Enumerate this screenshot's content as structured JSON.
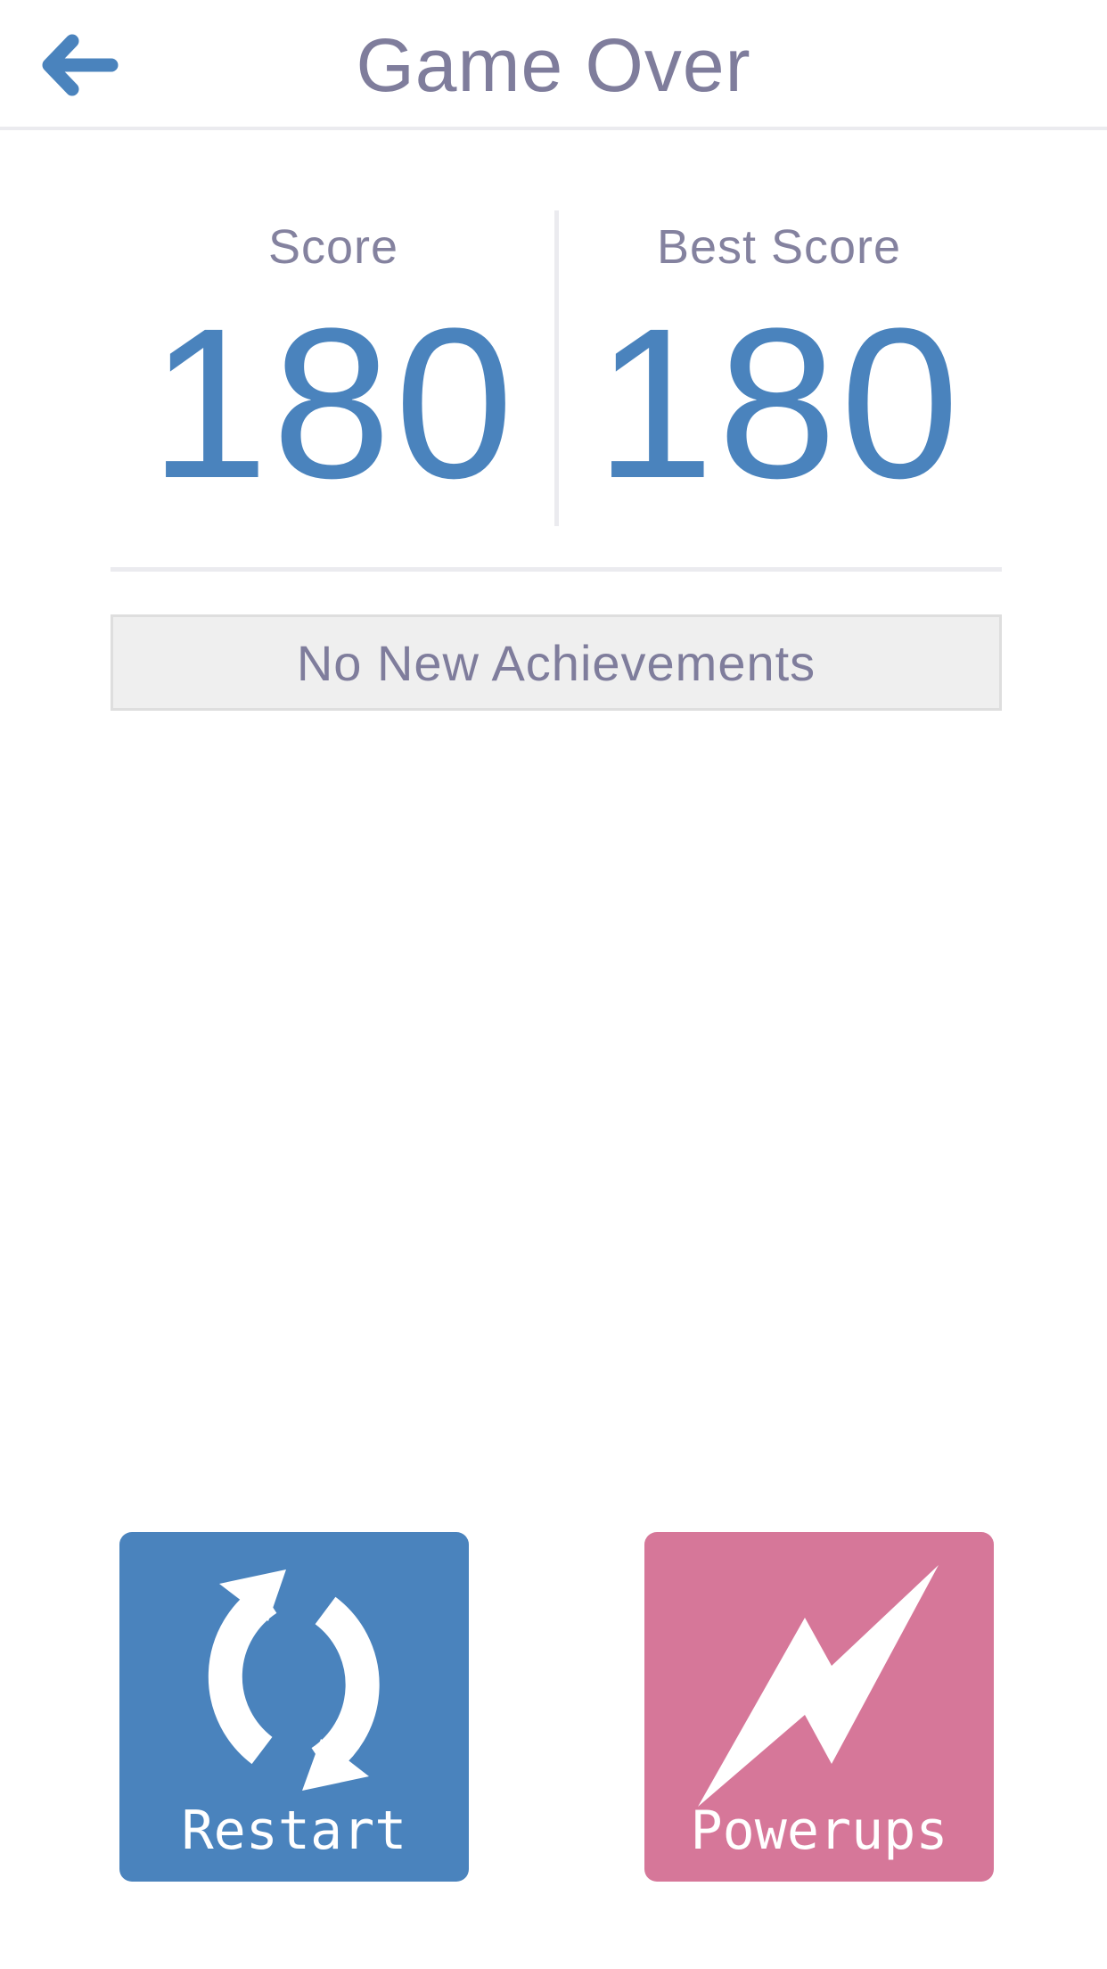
{
  "header": {
    "title": "Game Over",
    "back_icon": "back-arrow-icon"
  },
  "scores": {
    "score_label": "Score",
    "score_value": "180",
    "best_label": "Best Score",
    "best_value": "180"
  },
  "achievements": {
    "text": "No New Achievements"
  },
  "actions": {
    "restart_label": "Restart",
    "restart_icon": "refresh-icon",
    "powerups_label": "Powerups",
    "powerups_icon": "lightning-icon"
  },
  "colors": {
    "blue": "#4a83bd",
    "pink": "#d67799",
    "text_gray": "#7f7d9c"
  }
}
